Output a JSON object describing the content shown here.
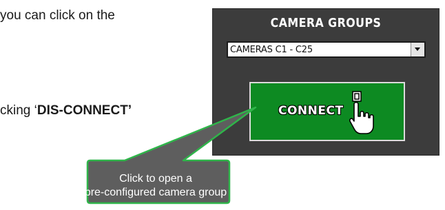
{
  "document": {
    "line1": "you can click on the",
    "line2_prefix": "cking ‘",
    "line2_bold": "DIS-CONNECT’"
  },
  "panel": {
    "title": "CAMERA GROUPS",
    "group_select": {
      "value": "CAMERAS C1 - C25"
    },
    "connect_button": {
      "label": "CONNECT",
      "icon": "pointing-hand-icon"
    }
  },
  "callout": {
    "line1": "Click to open a",
    "line2": "pre-configured camera group"
  },
  "colors": {
    "panel_bg": "#3c3c3c",
    "connect_green": "#0d8a22",
    "callout_fill": "#5e5e5e",
    "callout_border": "#2fb54a"
  }
}
